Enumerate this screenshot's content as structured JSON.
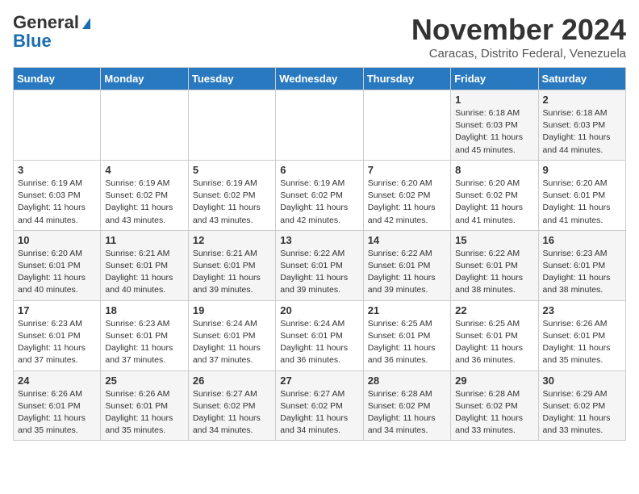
{
  "header": {
    "logo_general": "General",
    "logo_blue": "Blue",
    "month": "November 2024",
    "location": "Caracas, Distrito Federal, Venezuela"
  },
  "days_of_week": [
    "Sunday",
    "Monday",
    "Tuesday",
    "Wednesday",
    "Thursday",
    "Friday",
    "Saturday"
  ],
  "weeks": [
    [
      {
        "day": "",
        "info": ""
      },
      {
        "day": "",
        "info": ""
      },
      {
        "day": "",
        "info": ""
      },
      {
        "day": "",
        "info": ""
      },
      {
        "day": "",
        "info": ""
      },
      {
        "day": "1",
        "info": "Sunrise: 6:18 AM\nSunset: 6:03 PM\nDaylight: 11 hours\nand 45 minutes."
      },
      {
        "day": "2",
        "info": "Sunrise: 6:18 AM\nSunset: 6:03 PM\nDaylight: 11 hours\nand 44 minutes."
      }
    ],
    [
      {
        "day": "3",
        "info": "Sunrise: 6:19 AM\nSunset: 6:03 PM\nDaylight: 11 hours\nand 44 minutes."
      },
      {
        "day": "4",
        "info": "Sunrise: 6:19 AM\nSunset: 6:02 PM\nDaylight: 11 hours\nand 43 minutes."
      },
      {
        "day": "5",
        "info": "Sunrise: 6:19 AM\nSunset: 6:02 PM\nDaylight: 11 hours\nand 43 minutes."
      },
      {
        "day": "6",
        "info": "Sunrise: 6:19 AM\nSunset: 6:02 PM\nDaylight: 11 hours\nand 42 minutes."
      },
      {
        "day": "7",
        "info": "Sunrise: 6:20 AM\nSunset: 6:02 PM\nDaylight: 11 hours\nand 42 minutes."
      },
      {
        "day": "8",
        "info": "Sunrise: 6:20 AM\nSunset: 6:02 PM\nDaylight: 11 hours\nand 41 minutes."
      },
      {
        "day": "9",
        "info": "Sunrise: 6:20 AM\nSunset: 6:01 PM\nDaylight: 11 hours\nand 41 minutes."
      }
    ],
    [
      {
        "day": "10",
        "info": "Sunrise: 6:20 AM\nSunset: 6:01 PM\nDaylight: 11 hours\nand 40 minutes."
      },
      {
        "day": "11",
        "info": "Sunrise: 6:21 AM\nSunset: 6:01 PM\nDaylight: 11 hours\nand 40 minutes."
      },
      {
        "day": "12",
        "info": "Sunrise: 6:21 AM\nSunset: 6:01 PM\nDaylight: 11 hours\nand 39 minutes."
      },
      {
        "day": "13",
        "info": "Sunrise: 6:22 AM\nSunset: 6:01 PM\nDaylight: 11 hours\nand 39 minutes."
      },
      {
        "day": "14",
        "info": "Sunrise: 6:22 AM\nSunset: 6:01 PM\nDaylight: 11 hours\nand 39 minutes."
      },
      {
        "day": "15",
        "info": "Sunrise: 6:22 AM\nSunset: 6:01 PM\nDaylight: 11 hours\nand 38 minutes."
      },
      {
        "day": "16",
        "info": "Sunrise: 6:23 AM\nSunset: 6:01 PM\nDaylight: 11 hours\nand 38 minutes."
      }
    ],
    [
      {
        "day": "17",
        "info": "Sunrise: 6:23 AM\nSunset: 6:01 PM\nDaylight: 11 hours\nand 37 minutes."
      },
      {
        "day": "18",
        "info": "Sunrise: 6:23 AM\nSunset: 6:01 PM\nDaylight: 11 hours\nand 37 minutes."
      },
      {
        "day": "19",
        "info": "Sunrise: 6:24 AM\nSunset: 6:01 PM\nDaylight: 11 hours\nand 37 minutes."
      },
      {
        "day": "20",
        "info": "Sunrise: 6:24 AM\nSunset: 6:01 PM\nDaylight: 11 hours\nand 36 minutes."
      },
      {
        "day": "21",
        "info": "Sunrise: 6:25 AM\nSunset: 6:01 PM\nDaylight: 11 hours\nand 36 minutes."
      },
      {
        "day": "22",
        "info": "Sunrise: 6:25 AM\nSunset: 6:01 PM\nDaylight: 11 hours\nand 36 minutes."
      },
      {
        "day": "23",
        "info": "Sunrise: 6:26 AM\nSunset: 6:01 PM\nDaylight: 11 hours\nand 35 minutes."
      }
    ],
    [
      {
        "day": "24",
        "info": "Sunrise: 6:26 AM\nSunset: 6:01 PM\nDaylight: 11 hours\nand 35 minutes."
      },
      {
        "day": "25",
        "info": "Sunrise: 6:26 AM\nSunset: 6:01 PM\nDaylight: 11 hours\nand 35 minutes."
      },
      {
        "day": "26",
        "info": "Sunrise: 6:27 AM\nSunset: 6:02 PM\nDaylight: 11 hours\nand 34 minutes."
      },
      {
        "day": "27",
        "info": "Sunrise: 6:27 AM\nSunset: 6:02 PM\nDaylight: 11 hours\nand 34 minutes."
      },
      {
        "day": "28",
        "info": "Sunrise: 6:28 AM\nSunset: 6:02 PM\nDaylight: 11 hours\nand 34 minutes."
      },
      {
        "day": "29",
        "info": "Sunrise: 6:28 AM\nSunset: 6:02 PM\nDaylight: 11 hours\nand 33 minutes."
      },
      {
        "day": "30",
        "info": "Sunrise: 6:29 AM\nSunset: 6:02 PM\nDaylight: 11 hours\nand 33 minutes."
      }
    ]
  ]
}
